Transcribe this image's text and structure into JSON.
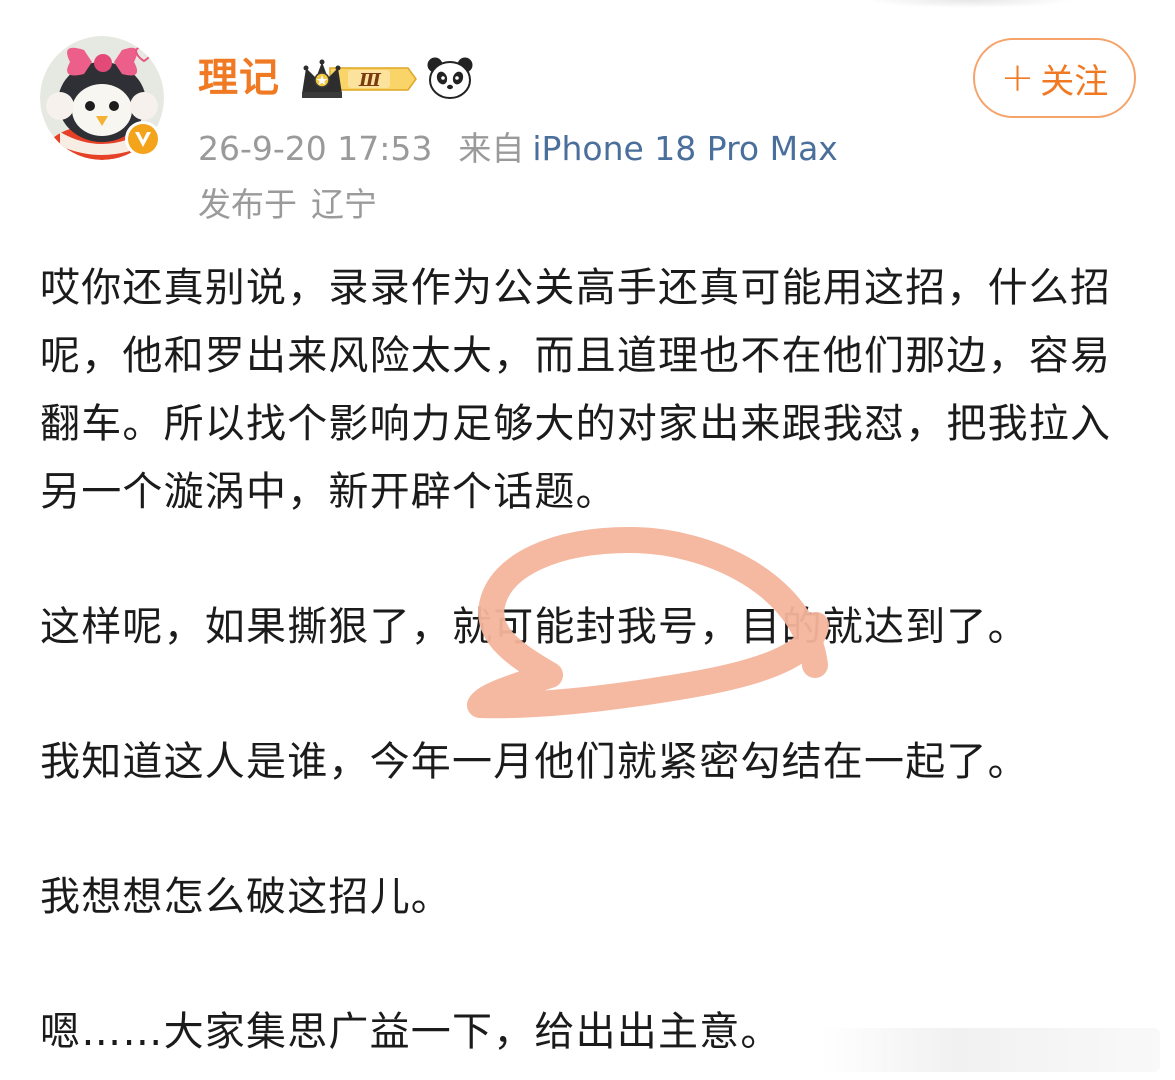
{
  "post": {
    "author": {
      "name": "理记",
      "level_badge": "Ⅲ"
    },
    "follow_button": {
      "plus": "+",
      "label": "关注"
    },
    "meta": {
      "time": "26-9-20 17:53",
      "source_label": "来自",
      "device": "iPhone 18 Pro Max",
      "location_label": "发布于",
      "location": "辽宁"
    },
    "paragraphs": [
      "哎你还真别说，录录作为公关高手还真可能用这招，什么招呢，他和罗出来风险太大，而且道理也不在他们那边，容易翻车。所以找个影响力足够大的对家出来跟我怼，把我拉入另一个漩涡中，新开辟个话题。",
      "这样呢，如果撕狠了，就可能封我号，目的就达到了。",
      "我知道这人是谁，今年一月他们就紧密勾结在一起了。",
      "我想想怎么破这招儿。",
      "嗯……大家集思广益一下，给出出主意。"
    ]
  },
  "colors": {
    "username": "#f07a24",
    "follow_border": "#f6a36a",
    "meta_gray": "#9a9a9a",
    "device_blue": "#4a6f9a",
    "text": "#1b1b1b",
    "scribble": "#f4b49b"
  },
  "icons": {
    "verified": "verified-v-badge-icon",
    "crown": "crown-level-badge-icon",
    "panda": "panda-icon"
  }
}
